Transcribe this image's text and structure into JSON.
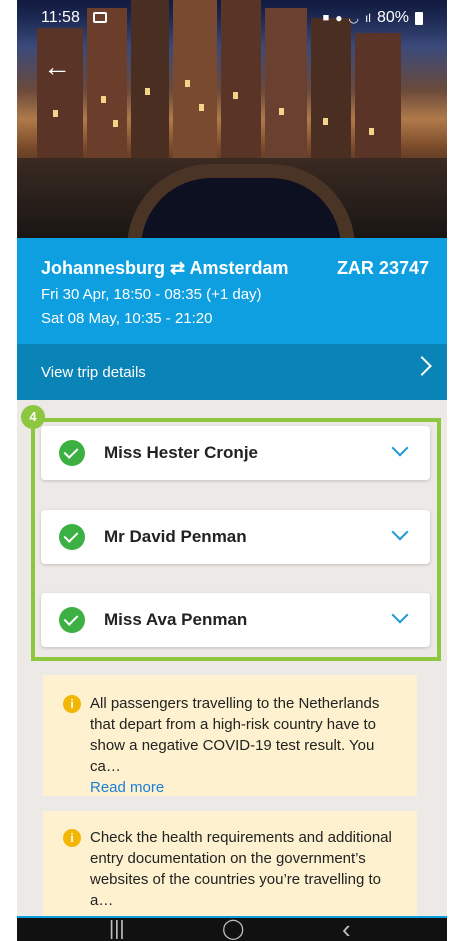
{
  "status": {
    "time": "11:58",
    "battery": "80%",
    "icons": [
      "photo-icon",
      "lock-icon",
      "location-icon",
      "wifi-icon",
      "volte-icon",
      "signal-icon",
      "battery-icon"
    ]
  },
  "hero": {
    "back_icon": "back-arrow-icon"
  },
  "trip": {
    "route_from": "Johannesburg",
    "route_sep": "⇄",
    "route_to": "Amsterdam",
    "price": "ZAR 23747",
    "date1": "Fri 30 Apr, 18:50 - 08:35 (+1 day)",
    "date2": "Sat 08 May, 10:35 - 21:20"
  },
  "details": {
    "label": "View trip details"
  },
  "passenger_badge": "4",
  "passengers": [
    {
      "name": "Miss Hester Cronje"
    },
    {
      "name": "Mr David  Penman"
    },
    {
      "name": "Miss Ava Penman"
    }
  ],
  "notices": [
    {
      "text": "All passengers travelling to the Netherlands that depart from a high-risk country have to show a negative COVID-19 test result. You ca…",
      "more": "Read more"
    },
    {
      "text": "Check the health requirements and additional entry documentation on the government’s websites of the countries you’re travelling to a…"
    }
  ],
  "nav": {
    "recent": "|||",
    "home": "◯",
    "back": "‹"
  },
  "colors": {
    "blue": "#0d9fe0",
    "dark_blue": "#0a84b6",
    "green": "#8dc63f",
    "check": "#3cb043",
    "notice_bg": "#fdf1cf"
  }
}
